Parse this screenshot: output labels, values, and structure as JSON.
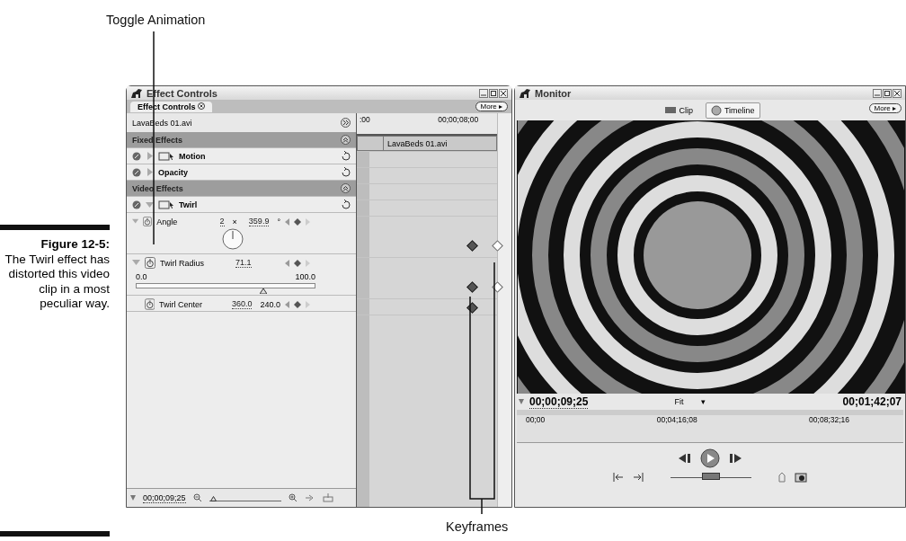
{
  "callouts": {
    "top": "Toggle Animation",
    "bottom": "Keyframes"
  },
  "caption": {
    "label": "Figure 12-5:",
    "text": "The Twirl effect has distorted this video clip in a most peculiar way."
  },
  "effect_controls": {
    "title": "Effect Controls",
    "tabs": [
      {
        "label": "Effect Controls",
        "selected": true
      }
    ],
    "more_button": "More ▸",
    "clip_name": "LavaBeds 01.avi",
    "ruler": {
      "start": ":00",
      "end": "00;00;08;00"
    },
    "clip_bar": "LavaBeds 01.avi",
    "rows": [
      {
        "kind": "section",
        "label": "Fixed Effects"
      },
      {
        "kind": "effect",
        "label": "Motion",
        "expanded": false,
        "icon": true
      },
      {
        "kind": "effect",
        "label": "Opacity",
        "expanded": false,
        "icon": false
      },
      {
        "kind": "section",
        "label": "Video Effects"
      },
      {
        "kind": "effect",
        "label": "Twirl",
        "expanded": true,
        "icon": true
      },
      {
        "kind": "param",
        "label": "Angle",
        "expanded": true,
        "values": [
          "2",
          "×",
          "359.9",
          "°"
        ],
        "dial": true,
        "keyframes": [
          {
            "kind": "filled"
          },
          {
            "kind": "hollow"
          }
        ]
      },
      {
        "kind": "param",
        "label": "Twirl Radius",
        "expanded": true,
        "values": [
          "71.1"
        ],
        "slider": {
          "min": "0.0",
          "max": "100.0",
          "level": 0.71
        },
        "keyframes": [
          {
            "kind": "filled"
          },
          {
            "kind": "hollow"
          }
        ]
      },
      {
        "kind": "param",
        "label": "Twirl Center",
        "expanded": false,
        "values": [
          "360.0",
          "240.0"
        ],
        "keyframes": [
          {
            "kind": "filled"
          }
        ]
      }
    ],
    "zoom_slider": {
      "level": 0.05
    },
    "timecode": "00;00;09;25"
  },
  "monitor": {
    "title": "Monitor",
    "tabs": [
      {
        "label": "Clip",
        "selected": false
      },
      {
        "label": "Timeline",
        "selected": true
      }
    ],
    "more_button": "More ▸",
    "timecode": "00;00;09;25",
    "zoom": "Fit",
    "zoom_caret": "▾",
    "duration": "00;01;42;07",
    "ruler": [
      "00;00",
      "00;04;16;08",
      "00;08;32;16"
    ],
    "shuttle": {
      "level": 0.5
    }
  }
}
